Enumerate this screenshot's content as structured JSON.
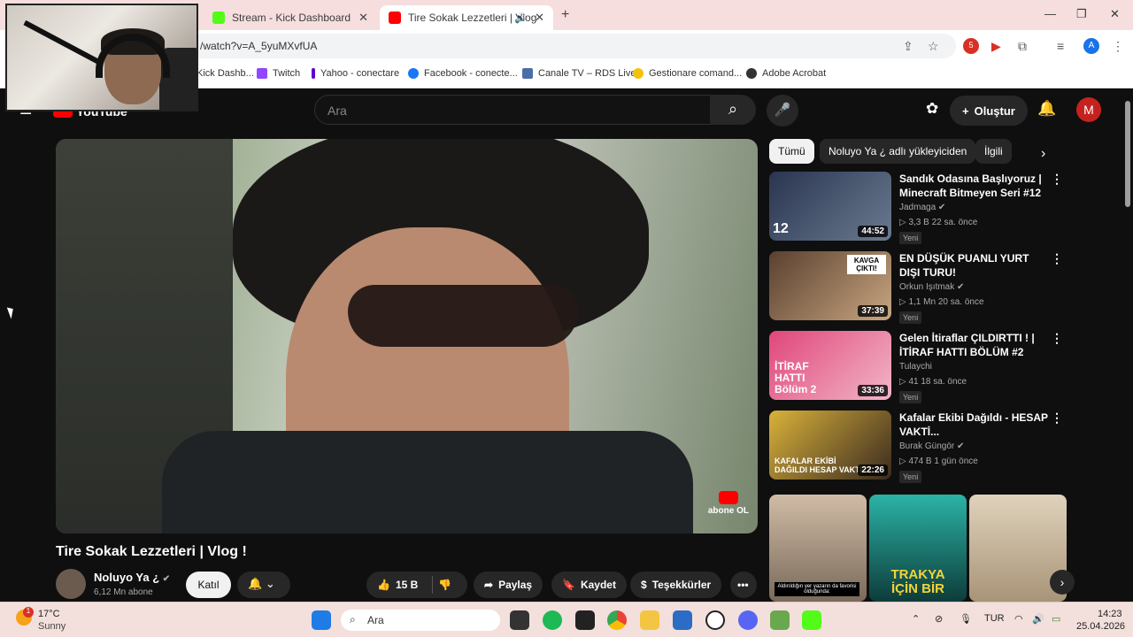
{
  "browser": {
    "tabs": [
      {
        "label": "Stream - Kick Dashboard",
        "color": "#53fc18"
      },
      {
        "label": "Tire Sokak Lezzetleri | Vlog",
        "color": "#ff0000"
      }
    ],
    "url": "/watch?v=A_5yuMXvfUA",
    "bookmarks": [
      "Kick Dashb...",
      "Twitch",
      "Yahoo - conectare",
      "Facebook - conecte...",
      "Canale TV – RDS Live",
      "Gestionare comand...",
      "Adobe Acrobat"
    ],
    "profile_initial": "A",
    "ext_badge": "5"
  },
  "youtube": {
    "logo": "YouTube",
    "search_placeholder": "Ara",
    "create_label": "Oluştur",
    "avatar_initial": "M",
    "video": {
      "title": "Tire Sokak Lezzetleri | Vlog !",
      "channel": "Noluyo Ya ¿",
      "subs": "6,12 Mn abone",
      "subscribe_badge": "abone OL",
      "join_label": "Katıl",
      "likes": "15 B",
      "share_label": "Paylaş",
      "save_label": "Kaydet",
      "thanks_label": "Teşekkürler"
    },
    "chips": [
      "Tümü",
      "Noluyo Ya ¿ adlı yükleyiciden",
      "İlgili"
    ],
    "recommendations": [
      {
        "title": "Sandık Odasına Başlıyoruz | Minecraft Bitmeyen Seri #12",
        "channel": "Jadmaga",
        "meta": "▷ 3,3 B   22 sa. önce",
        "new": "Yeni",
        "duration": "44:52",
        "thumb_color": "#3a4a6a",
        "overlay": "12"
      },
      {
        "title": "EN DÜŞÜK PUANLI YURT DIŞI TURU!",
        "channel": "Orkun Işıtmak",
        "meta": "▷ 1,1 Mn   20 sa. önce",
        "new": "Yeni",
        "duration": "37:39",
        "thumb_color": "#8a6a4e",
        "overlay": "KAVGA ÇIKTI!"
      },
      {
        "title": "Gelen İtiraflar ÇILDIRTTI ! | İTİRAF HATTI BÖLÜM #2",
        "channel": "Tulaychi",
        "meta": "▷ 41   18 sa. önce",
        "new": "Yeni",
        "duration": "33:36",
        "thumb_color": "#e0467a",
        "overlay": "İTİRAF HATTI Bölüm 2"
      },
      {
        "title": "Kafalar Ekibi Dağıldı - HESAP VAKTİ...",
        "channel": "Burak Güngör",
        "meta": "▷ 474 B   1 gün önce",
        "new": "Yeni",
        "duration": "22:26",
        "thumb_color": "#c9a83a",
        "overlay": "KAFALAR EKİBİ DAĞILDI HESAP VAKTİ"
      }
    ],
    "shorts": [
      {
        "color": "#b8a08a",
        "caption": "Aldırıldığın yer yazarın da favorisi olduğunda:"
      },
      {
        "color": "#28a59a",
        "caption": "TRAKYA İÇİN BİR"
      },
      {
        "color": "#c8b8a0",
        "caption": ""
      }
    ]
  },
  "taskbar": {
    "weather_temp": "17°C",
    "weather_desc": "Sunny",
    "weather_badge": "1",
    "search_label": "Ara",
    "lang": "TUR",
    "time": "14:23",
    "date": "25.04.2026"
  }
}
